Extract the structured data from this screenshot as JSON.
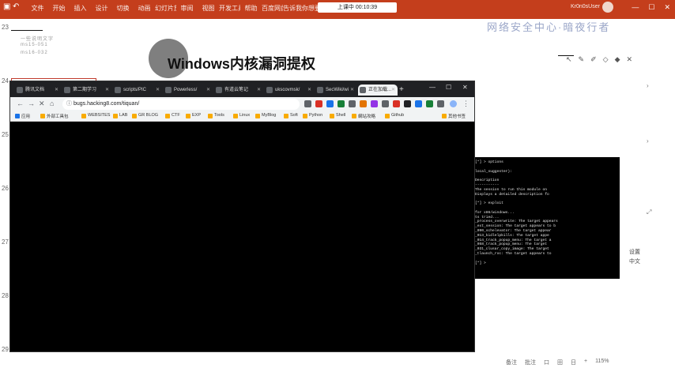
{
  "ribbon": {
    "menu": [
      "文件",
      "开始",
      "插入",
      "设计",
      "切换",
      "动画",
      "幻灯片放映",
      "审阅",
      "视图",
      "开发工具",
      "帮助",
      "百度网盘",
      "告诉我你想要做"
    ],
    "clock": "上课中 00:10:39",
    "user": "Kr0n0sUser",
    "accent": "#c43e1c"
  },
  "slide": {
    "title": "Windows内核漏洞提权",
    "overlay_text": "网络安全中心·暗夜行者",
    "line_numbers": [
      "23",
      "24",
      "25",
      "26",
      "27",
      "28",
      "29"
    ],
    "ghost_lines": [
      "一些说明文字",
      "ms15-051",
      "ms16-032"
    ],
    "side_labels": [
      "设置",
      "中文"
    ],
    "bottom": [
      "备注",
      "批注",
      "口",
      "田",
      "日",
      "+",
      "115%"
    ]
  },
  "browser": {
    "tabs": [
      {
        "label": "腾讯文档",
        "active": false
      },
      {
        "label": "第二期学习",
        "active": false
      },
      {
        "label": "scripts/PIC",
        "active": false
      },
      {
        "label": "Powerless/",
        "active": false
      },
      {
        "label": "有道云笔记",
        "active": false
      },
      {
        "label": "ukscovmsk/",
        "active": false
      },
      {
        "label": "SecWiki/wi",
        "active": false
      },
      {
        "label": "正在加载...",
        "active": true
      }
    ],
    "url": "bugs.hacking8.com/tiquan/",
    "bookmarks": [
      "应用",
      "外部工具包",
      "WEBSITES",
      "LAB",
      "GR BLOG",
      "CTF",
      "EXP",
      "Tools",
      "Linux",
      "MyBlog",
      "Soft",
      "Python",
      "Shell",
      "網站攻略",
      "Github",
      "其他书签"
    ]
  },
  "terminal": {
    "lines": [
      "[*] > options",
      "",
      "local_suggester):",
      "",
      "  Description",
      "  -----------",
      "  The session to run this module on",
      "  Displays a detailed description fo",
      "",
      "[*] > exploit",
      "",
      "  for x86/windows...",
      "  ts tried...",
      "  _process_overwrite: The target appears",
      "  _ext_session: The target appears to b",
      "  _090_schelevator: The target appear",
      "  _013_kidlelpkills: The target appe",
      "  _014_track_popup_menu: The target a",
      "  _058_track_popup_menu: The target",
      "  _031_clusar_copy_image: The target",
      "  _tlaunch_roc: The target appears to",
      "",
      "[*] >"
    ]
  }
}
